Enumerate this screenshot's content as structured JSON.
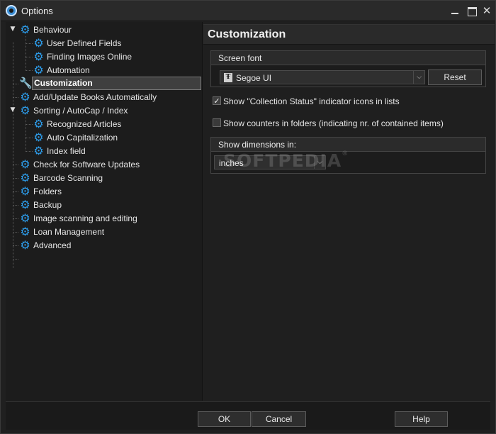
{
  "window": {
    "title": "Options",
    "icons": {
      "app": "app-logo-icon",
      "minimize": "minimize-icon",
      "maximize": "maximize-icon",
      "close": "close-icon"
    }
  },
  "tree": {
    "items": [
      {
        "label": "Behaviour",
        "icon": "gear-icon",
        "expanded": true
      },
      {
        "label": "User Defined Fields",
        "icon": "gear-icon"
      },
      {
        "label": "Finding Images Online",
        "icon": "gear-icon"
      },
      {
        "label": "Automation",
        "icon": "gear-icon"
      },
      {
        "label": "Customization",
        "icon": "wrench-icon",
        "selected": true
      },
      {
        "label": "Add/Update Books Automatically",
        "icon": "gear-icon"
      },
      {
        "label": "Sorting / AutoCap / Index",
        "icon": "gear-icon",
        "expanded": true
      },
      {
        "label": "Recognized Articles",
        "icon": "gear-icon"
      },
      {
        "label": "Auto Capitalization",
        "icon": "gear-icon"
      },
      {
        "label": "Index field",
        "icon": "gear-icon"
      },
      {
        "label": "Check for Software Updates",
        "icon": "gear-icon"
      },
      {
        "label": "Barcode Scanning",
        "icon": "gear-icon"
      },
      {
        "label": "Folders",
        "icon": "gear-icon"
      },
      {
        "label": "Backup",
        "icon": "gear-icon"
      },
      {
        "label": "Image scanning and editing",
        "icon": "gear-icon"
      },
      {
        "label": "Loan Management",
        "icon": "gear-icon"
      },
      {
        "label": "Advanced",
        "icon": "gear-icon"
      }
    ]
  },
  "panel": {
    "title": "Customization",
    "screen_font": {
      "group_title": "Screen font",
      "font_value": "Segoe UI",
      "reset_label": "Reset"
    },
    "show_collection_status": {
      "label": "Show \"Collection Status\" indicator icons in lists",
      "checked": true
    },
    "show_counters": {
      "label": "Show counters in folders (indicating nr. of contained items)",
      "checked": false
    },
    "dimensions": {
      "group_title": "Show dimensions in:",
      "value": "inches"
    }
  },
  "watermark": {
    "text": "SOFTPEDIA",
    "mark": "®"
  },
  "footer": {
    "ok_label": "OK",
    "cancel_label": "Cancel",
    "help_label": "Help"
  },
  "colors": {
    "accent": "#2d9be8",
    "background": "#202020",
    "selection": "#3f3f3f"
  }
}
